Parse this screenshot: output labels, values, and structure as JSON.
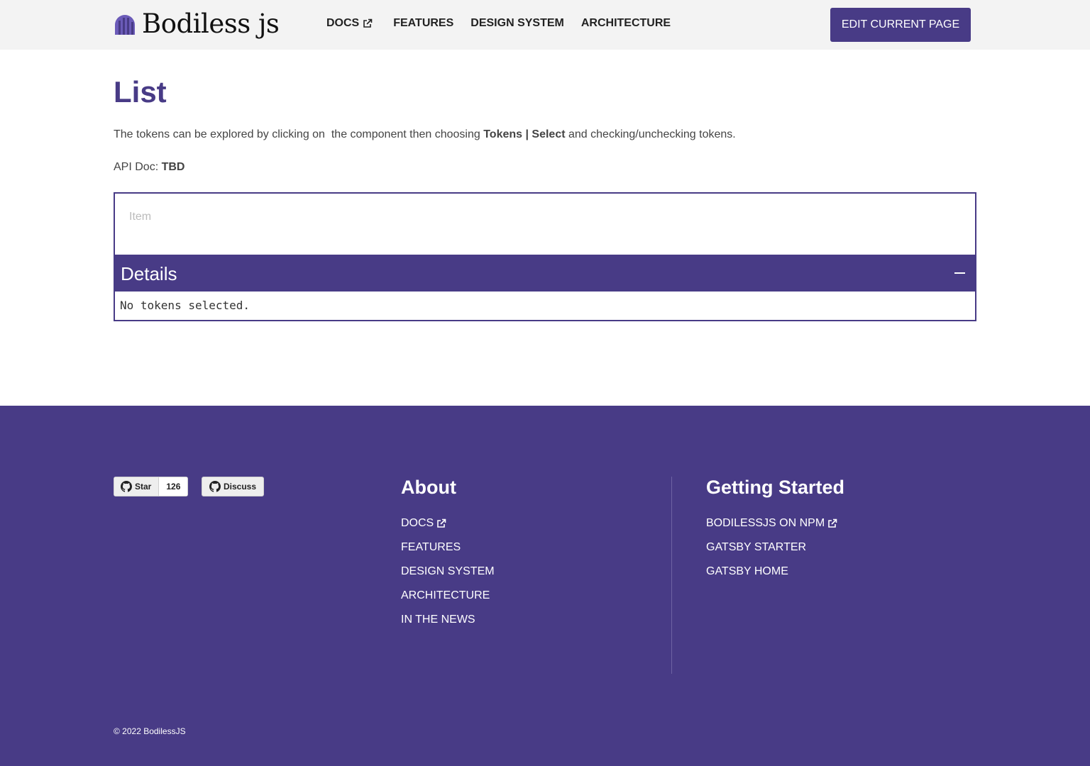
{
  "header": {
    "logo_text": "Bodiless js",
    "nav": [
      {
        "label": "DOCS",
        "external": true
      },
      {
        "label": "FEATURES"
      },
      {
        "label": "DESIGN SYSTEM"
      },
      {
        "label": "ARCHITECTURE"
      }
    ],
    "edit_button": "EDIT CURRENT PAGE"
  },
  "main": {
    "title": "List",
    "intro_pre": "The tokens can be explored by clicking on  the component then choosing ",
    "intro_bold": "Tokens | Select",
    "intro_post": " and checking/unchecking tokens.",
    "api_label": "API Doc: ",
    "api_value": "TBD",
    "list_item_placeholder": "Item",
    "details_title": "Details",
    "details_body": "No tokens selected."
  },
  "footer": {
    "github_star_label": "Star",
    "github_star_count": "126",
    "github_discuss_label": "Discuss",
    "about_title": "About",
    "about_links": [
      {
        "label": "DOCS",
        "external": true
      },
      {
        "label": "FEATURES"
      },
      {
        "label": "DESIGN SYSTEM"
      },
      {
        "label": "ARCHITECTURE"
      },
      {
        "label": "IN THE NEWS"
      }
    ],
    "getting_started_title": "Getting Started",
    "getting_started_links": [
      {
        "label": "BODILESSJS ON NPM",
        "external": true
      },
      {
        "label": "GATSBY STARTER"
      },
      {
        "label": "GATSBY HOME"
      }
    ],
    "copyright": "©  2022 BodilessJS"
  },
  "colors": {
    "brand": "#483b86",
    "header_bg": "#f3f3f3"
  }
}
